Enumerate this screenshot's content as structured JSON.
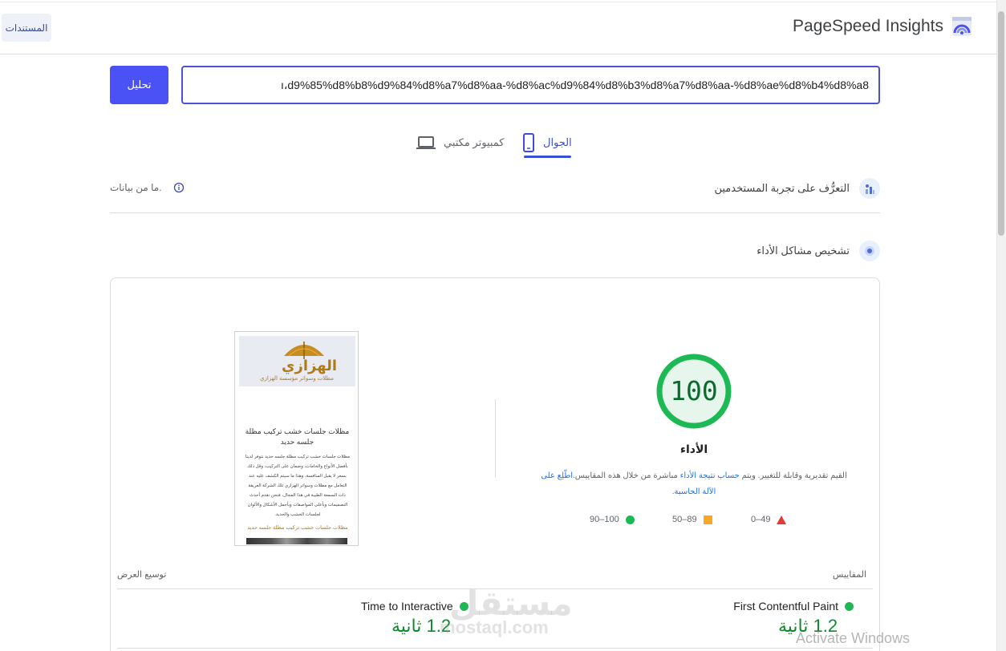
{
  "header": {
    "brand_title": "PageSpeed Insights",
    "docs_label": "المستندات"
  },
  "url_bar": {
    "analyze_label": "تحليل",
    "url_value": "ı،d9%85%d8%b8%d9%84%d8%a7%d8%aa-%d8%ac%d9%84%d8%b3%d8%a7%d8%aa-%d8%ae%d8%b4%d8%a8"
  },
  "tabs": [
    {
      "label": "الجوال",
      "icon": "mobile-icon",
      "selected": true
    },
    {
      "label": "كمبيوتر مكتبي",
      "icon": "desktop-icon",
      "selected": false
    }
  ],
  "field_data": {
    "title": "التعرُّف على تجربة المستخدمين",
    "no_data": "ما من بيانات."
  },
  "diagnose": {
    "title": "تشخيص مشاكل الأداء"
  },
  "score": {
    "value": "100",
    "value_fraction": 1.0,
    "label": "الأداء",
    "desc_prefix": "القيم تقديرية وقابلة للتغيير. ويتم",
    "desc_link1": "حساب نتيجة الأداء",
    "desc_middle": "مباشرة من خلال هذه المقاييس.",
    "desc_link2": "اطّلِع على الآلة الحاسبة",
    "color": "#1db954"
  },
  "legend": [
    {
      "range": "0–49",
      "shape": "triangle",
      "color": "#e53935"
    },
    {
      "range": "50–89",
      "shape": "square",
      "color": "#f9a825"
    },
    {
      "range": "90–100",
      "shape": "circle",
      "color": "#1db954"
    }
  ],
  "preview": {
    "brand": "الهزازي",
    "subtitle": "مظلات وسواتر مؤسسة الهزازي",
    "title": "مظلات جلسات خشب تركيب مظلة جلسه حديد",
    "body": "مظلات جلسات خشب تركيب مظلة جلسه حديد نتوفر لدينا بأفضل الأنواع والخامات، وضمان على التركيب، وقل ذلك بسعر لا يقبل المنافسة، وهذا ما سيتم الكشف عليه عند التعامل مع مظلات وسواتر الهزازي تلك الشركة العريقة ذات السمعة الطيبة في هذا المجال، فنحن نقدم أحدث التصميمات وبأعلى المواصفات وبأجمل الأشكال والألوان لجلسات الخشب والحديد.",
    "link": "مظلات جلسات خشب تركيب مظلة جلسه حديد"
  },
  "metrics": {
    "section_label": "المقاييس",
    "expand_label": "توسيع العرض",
    "items": [
      {
        "name": "First Contentful Paint",
        "value": "1.2 ثانية"
      },
      {
        "name": "Time to Interactive",
        "value": "1.2 ثانية"
      }
    ]
  },
  "overlay": {
    "watermark": "مستقل",
    "watermark_url": "mostaql.com",
    "activate": "Activate Windows"
  }
}
